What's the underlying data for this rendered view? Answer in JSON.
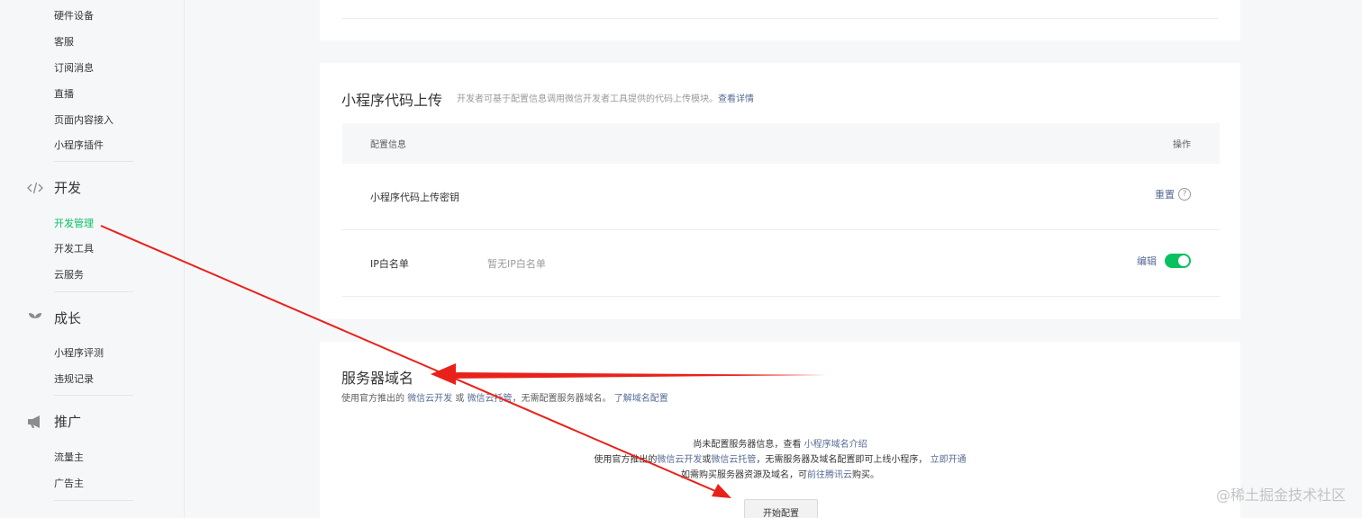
{
  "sidebar": {
    "items_top": [
      "硬件设备",
      "客服",
      "订阅消息",
      "直播",
      "页面内容接入",
      "小程序插件"
    ],
    "sections": [
      {
        "title": "开发",
        "icon": "code-icon",
        "items": [
          "开发管理",
          "开发工具",
          "云服务"
        ],
        "active": "开发管理"
      },
      {
        "title": "成长",
        "icon": "sprout-icon",
        "items": [
          "小程序评测",
          "违规记录"
        ]
      },
      {
        "title": "推广",
        "icon": "megaphone-icon",
        "items": [
          "流量主",
          "广告主"
        ]
      }
    ]
  },
  "upload_card": {
    "title": "小程序代码上传",
    "desc": "开发者可基于配置信息调用微信开发者工具提供的代码上传模块。",
    "desc_link": "查看详情",
    "table_header": {
      "col1": "配置信息",
      "col2": "操作"
    },
    "rows": [
      {
        "label": "小程序代码上传密钥",
        "value": "",
        "action": "重置"
      },
      {
        "label": "IP白名单",
        "value": "暂无IP白名单",
        "action": "编辑",
        "toggle_on": true
      }
    ]
  },
  "server_card": {
    "title": "服务器域名",
    "sub_prefix": "使用官方推出的",
    "sub_link1": "微信云开发",
    "sub_or": "或",
    "sub_link2": "微信云托管",
    "sub_middle": "，无需配置服务器域名。",
    "sub_link3": "了解域名配置",
    "empty_line1_prefix": "尚未配置服务器信息，查看",
    "empty_line1_link": "小程序域名介绍",
    "empty_line2_prefix": "使用官方推出的",
    "empty_line2_link1": "微信云开发",
    "empty_line2_or": "或",
    "empty_line2_link2": "微信云托管",
    "empty_line2_middle": "，无需服务器及域名配置即可上线小程序，",
    "empty_line2_link3": "立即开通",
    "empty_line3_prefix": "如需购买服务器资源及域名，可",
    "empty_line3_link": "前往腾讯云",
    "empty_line3_suffix": "购买。",
    "button": "开始配置"
  },
  "watermark": "@稀土掘金技术社区",
  "colors": {
    "accent": "#07c160",
    "link": "#576b95",
    "arrow": "#e8221b"
  }
}
